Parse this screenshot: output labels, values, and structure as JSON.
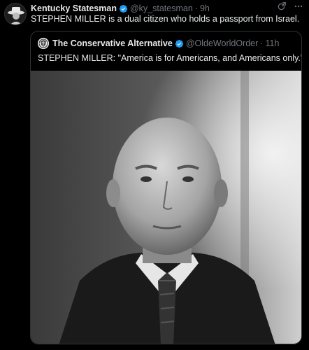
{
  "tweet": {
    "author_name": "Kentucky Statesman",
    "handle": "@ky_statesman",
    "separator": "·",
    "time": "9h",
    "text": "STEPHEN MILLER is a dual citizen who holds a passport from Israel."
  },
  "quoted_tweet": {
    "author_name": "The Conservative Alternative",
    "handle": "@OldeWorldOrder",
    "separator": "·",
    "time": "11h",
    "text": "STEPHEN MILLER: \"America is for Americans, and Americans only.\""
  },
  "icons": {
    "avatar": "hat-silhouette-avatar",
    "verified": "verified-badge-icon",
    "grok": "grok-icon",
    "more": "more-icon",
    "quote_avatar": "shield-logo-avatar",
    "photo": "black-and-white-portrait-photo"
  },
  "colors": {
    "background": "#000000",
    "text": "#e7e9ea",
    "muted": "#71767b",
    "verified": "#1d9bf0",
    "border": "#2f3336"
  }
}
